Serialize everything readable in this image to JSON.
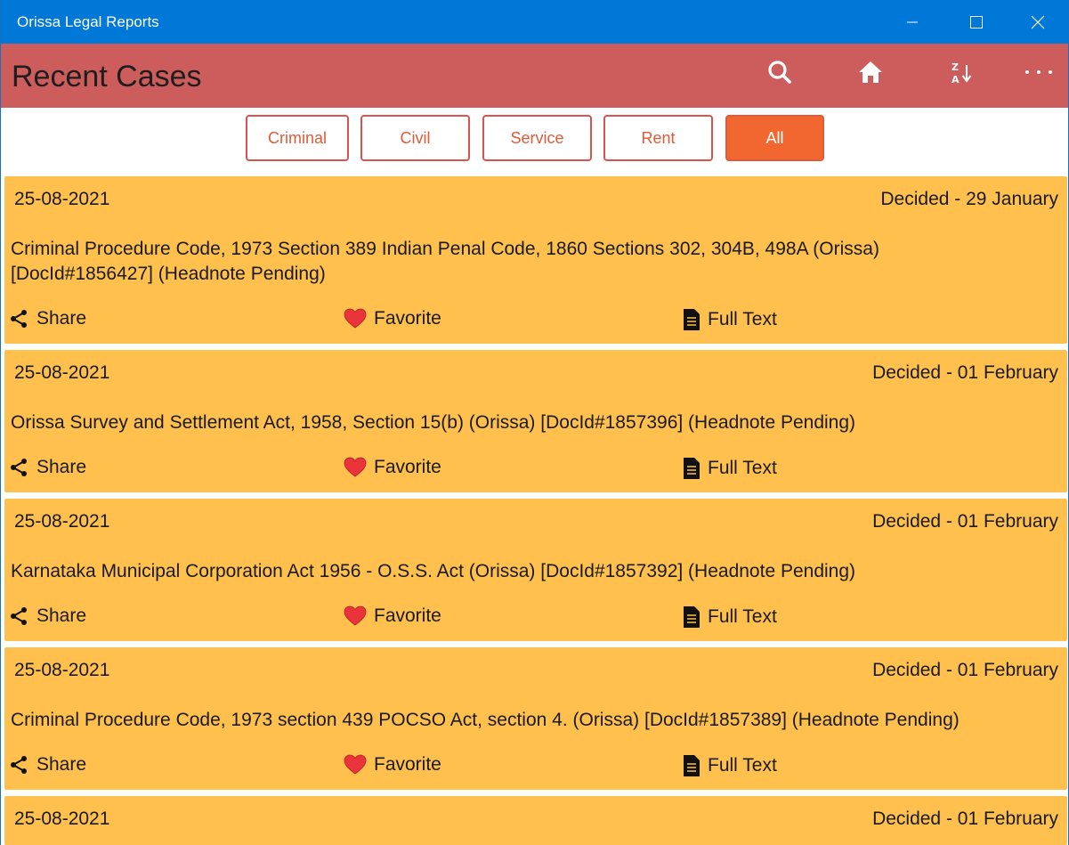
{
  "window": {
    "title": "Orissa Legal Reports"
  },
  "header": {
    "page_title": "Recent Cases",
    "icons": [
      "search-icon",
      "home-icon",
      "sort-az-icon",
      "more-icon"
    ]
  },
  "filters": [
    {
      "label": "Criminal",
      "active": false
    },
    {
      "label": "Civil",
      "active": false
    },
    {
      "label": "Service",
      "active": false
    },
    {
      "label": "Rent",
      "active": false
    },
    {
      "label": "All",
      "active": true
    }
  ],
  "actions": {
    "share": "Share",
    "favorite": "Favorite",
    "full_text": "Full Text"
  },
  "cases": [
    {
      "date": "25-08-2021",
      "decided": "Decided - 29 January",
      "title": "Criminal Procedure Code, 1973 Section 389 Indian Penal Code, 1860 Sections 302, 304B, 498A (Orissa) [DocId#1856427] (Headnote Pending)"
    },
    {
      "date": "25-08-2021",
      "decided": "Decided - 01 February",
      "title": "Orissa Survey and Settlement Act, 1958, Section 15(b)  (Orissa) [DocId#1857396] (Headnote Pending)"
    },
    {
      "date": "25-08-2021",
      "decided": "Decided - 01 February",
      "title": "Karnataka Municipal Corporation Act 1956 - O.S.S. Act (Orissa) [DocId#1857392] (Headnote Pending)"
    },
    {
      "date": "25-08-2021",
      "decided": "Decided - 01 February",
      "title": "Criminal Procedure Code, 1973 section 439 POCSO Act, section 4. (Orissa) [DocId#1857389] (Headnote Pending)"
    },
    {
      "date": "25-08-2021",
      "decided": "Decided - 01 February",
      "title": ""
    }
  ],
  "colors": {
    "titlebar": "#0078d7",
    "header": "#cd5c5c",
    "card": "#ffc04e",
    "active_filter": "#f26630",
    "heart": "#e8343a"
  }
}
